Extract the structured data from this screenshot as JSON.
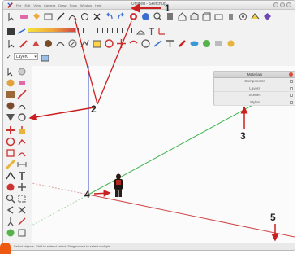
{
  "window": {
    "title": "Untitled - SketchUp"
  },
  "menu": [
    "File",
    "Edit",
    "View",
    "Camera",
    "Draw",
    "Tools",
    "Window",
    "Help"
  ],
  "layer": {
    "name": "Layer0"
  },
  "tray": {
    "title": "Materials",
    "items": [
      "Components",
      "Layers",
      "Scenes",
      "Styles"
    ]
  },
  "status_bar": {
    "text": "Select objects. Shift to extend select. Drag mouse to select multiple."
  },
  "callouts": [
    "1",
    "2",
    "3",
    "4",
    "5"
  ],
  "colors": {
    "accent_red": "#cc1f1f",
    "axis_green": "#3cb44b",
    "axis_blue": "#3546c8",
    "axis_red": "#d04545",
    "tray_close": "#d94b3d",
    "brand_orange": "#ee5a11"
  },
  "toolbar_icons": {
    "row1": [
      "select-icon",
      "eraser-icon",
      "paint-bucket-icon",
      "rectangle-icon",
      "line-icon",
      "arc-icon",
      "shape-icon",
      "rotate-icon",
      "undo-icon",
      "redo-icon",
      "orbit-icon",
      "pan-icon",
      "zoom-icon",
      "3d-warehouse-icon",
      "component-icon",
      "house-icon",
      "front-view-icon",
      "box-icon",
      "camera-icon",
      "walk-icon",
      "look-around-icon",
      "section-icon"
    ],
    "row2": [
      "color-swatch-icon",
      "dimension-icon",
      "protractor-icon",
      "text-icon",
      "axes-icon",
      "3d-text-icon",
      "measurements-icon"
    ],
    "row3": [
      "arrow-icon",
      "pencil-icon",
      "circle-icon",
      "polygon-icon",
      "freehand-icon",
      "push-pull-icon",
      "follow-me-icon",
      "move-icon",
      "rotate-icon",
      "scale-icon",
      "offset-icon",
      "tape-icon",
      "protractor-icon",
      "text-icon",
      "orbit-icon",
      "zoom-icon",
      "zoom-extents-icon",
      "previous-icon",
      "next-icon"
    ]
  }
}
